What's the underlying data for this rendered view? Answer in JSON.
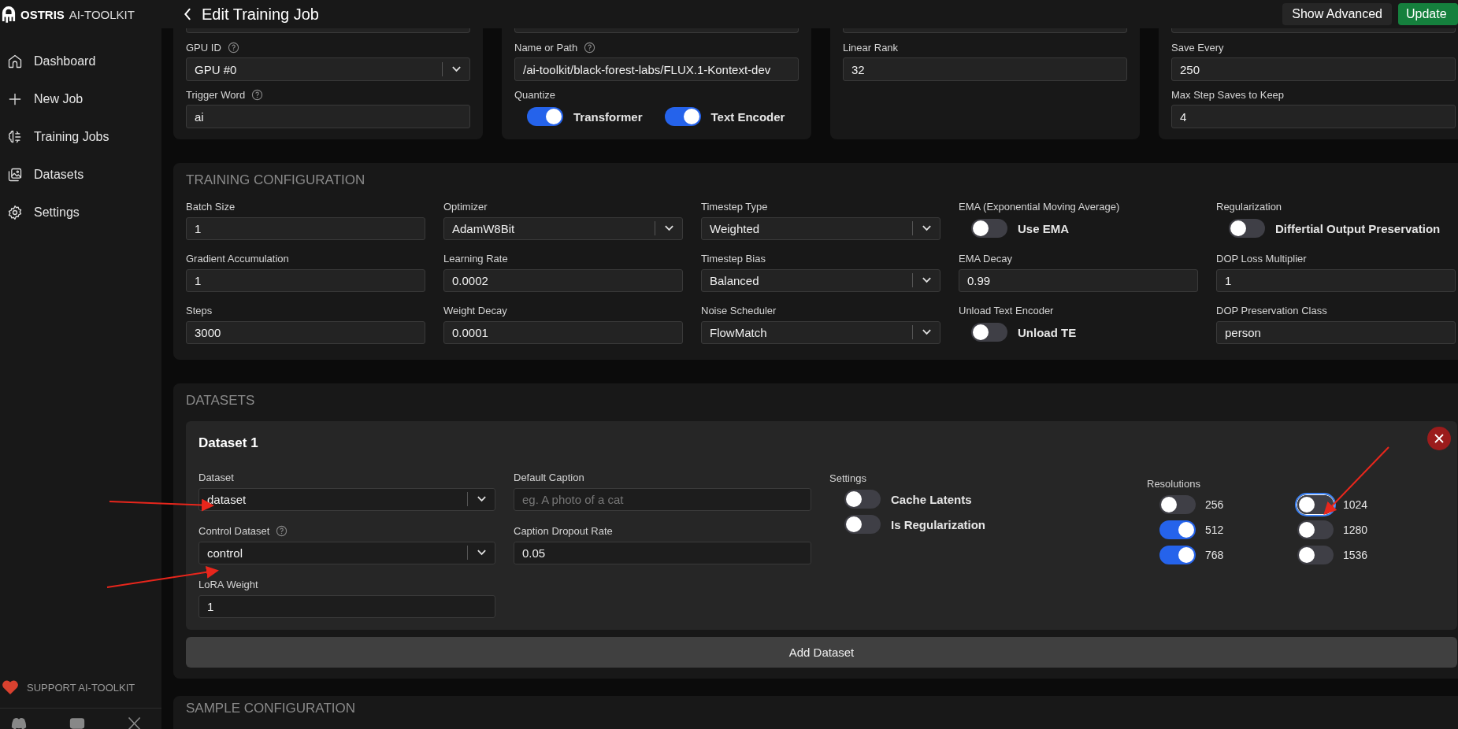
{
  "sidebar": {
    "brand": "OSTRIS",
    "brand_sub": "AI-TOOLKIT",
    "items": [
      {
        "label": "Dashboard"
      },
      {
        "label": "New Job"
      },
      {
        "label": "Training Jobs"
      },
      {
        "label": "Datasets"
      },
      {
        "label": "Settings"
      }
    ],
    "support": "SUPPORT AI-TOOLKIT"
  },
  "header": {
    "title": "Edit Training Job",
    "buttons": [
      {
        "label": "Show Advanced",
        "kind": "secondary"
      },
      {
        "label": "Update",
        "kind": "primary"
      }
    ]
  },
  "top_cards": [
    {
      "fields": [
        {
          "kind": "select",
          "label": "GPU ID",
          "help": true,
          "value": "GPU #0"
        },
        {
          "kind": "text",
          "label": "Trigger Word",
          "help": true,
          "value": "ai"
        }
      ]
    },
    {
      "fields": [
        {
          "kind": "text",
          "label": "Name or Path",
          "help": true,
          "value": "/ai-toolkit/black-forest-labs/FLUX.1-Kontext-dev"
        },
        {
          "kind": "toggles",
          "label": "Quantize",
          "toggles": [
            {
              "label": "Transformer",
              "on": true
            },
            {
              "label": "Text Encoder",
              "on": true
            }
          ]
        }
      ]
    },
    {
      "fields": [
        {
          "kind": "text",
          "label": "Linear Rank",
          "help": false,
          "value": "32"
        }
      ]
    },
    {
      "fields": [
        {
          "kind": "text",
          "label": "Save Every",
          "help": false,
          "value": "250"
        },
        {
          "kind": "text",
          "label": "Max Step Saves to Keep",
          "help": false,
          "value": "4"
        }
      ]
    }
  ],
  "training": {
    "title": "TRAINING CONFIGURATION",
    "columns": [
      [
        {
          "kind": "text",
          "label": "Batch Size",
          "value": "1"
        },
        {
          "kind": "text",
          "label": "Gradient Accumulation",
          "value": "1"
        },
        {
          "kind": "text",
          "label": "Steps",
          "value": "3000"
        }
      ],
      [
        {
          "kind": "select",
          "label": "Optimizer",
          "value": "AdamW8Bit"
        },
        {
          "kind": "text",
          "label": "Learning Rate",
          "value": "0.0002"
        },
        {
          "kind": "text",
          "label": "Weight Decay",
          "value": "0.0001"
        }
      ],
      [
        {
          "kind": "select",
          "label": "Timestep Type",
          "value": "Weighted"
        },
        {
          "kind": "select",
          "label": "Timestep Bias",
          "value": "Balanced"
        },
        {
          "kind": "select",
          "label": "Noise Scheduler",
          "value": "FlowMatch"
        }
      ],
      [
        {
          "kind": "toggles",
          "label": "EMA (Exponential Moving Average)",
          "toggles": [
            {
              "label": "Use EMA",
              "on": false
            }
          ]
        },
        {
          "kind": "text",
          "label": "EMA Decay",
          "value": "0.99"
        },
        {
          "kind": "toggles",
          "label": "Unload Text Encoder",
          "toggles": [
            {
              "label": "Unload TE",
              "on": false
            }
          ]
        }
      ],
      [
        {
          "kind": "toggles",
          "label": "Regularization",
          "toggles": [
            {
              "label": "Differtial Output Preservation",
              "on": false
            }
          ]
        },
        {
          "kind": "text",
          "label": "DOP Loss Multiplier",
          "value": "1"
        },
        {
          "kind": "text",
          "label": "DOP Preservation Class",
          "value": "person"
        }
      ]
    ]
  },
  "datasets": {
    "title": "DATASETS",
    "items": [
      {
        "title": "Dataset 1",
        "columns": [
          [
            {
              "kind": "select",
              "label": "Dataset",
              "value": "dataset"
            },
            {
              "kind": "select",
              "label": "Control Dataset",
              "help": true,
              "value": "control"
            },
            {
              "kind": "text",
              "label": "LoRA Weight",
              "value": "1"
            }
          ],
          [
            {
              "kind": "text",
              "label": "Default Caption",
              "placeholder": "eg. A photo of a cat"
            },
            {
              "kind": "text",
              "label": "Caption Dropout Rate",
              "value": "0.05"
            }
          ],
          [
            {
              "kind": "toggles",
              "label": "Settings",
              "toggles": [
                {
                  "label": "Cache Latents",
                  "on": false
                },
                {
                  "label": "Is Regularization",
                  "on": false
                }
              ]
            }
          ],
          [
            {
              "kind": "resolutions",
              "label": "Resolutions",
              "toggles": [
                {
                  "label": "256",
                  "on": false,
                  "focused": false
                },
                {
                  "label": "512",
                  "on": true,
                  "focused": false
                },
                {
                  "label": "768",
                  "on": true,
                  "focused": false
                },
                {
                  "label": "1024",
                  "on": false,
                  "focused": true
                },
                {
                  "label": "1280",
                  "on": false,
                  "focused": false
                },
                {
                  "label": "1536",
                  "on": false,
                  "focused": false
                }
              ]
            }
          ]
        ]
      }
    ],
    "add_button": "Add Dataset"
  },
  "sample": {
    "title": "SAMPLE CONFIGURATION"
  }
}
